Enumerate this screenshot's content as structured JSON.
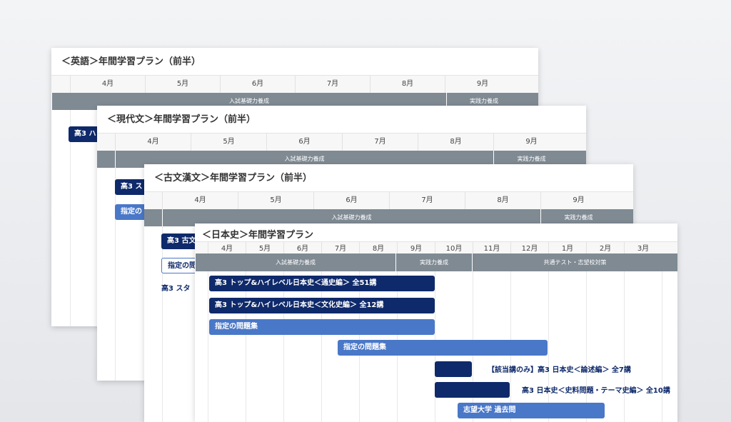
{
  "cards": [
    {
      "title": "＜英語＞年間学習プラン（前半）",
      "months": [
        "4月",
        "5月",
        "6月",
        "7月",
        "8月",
        "9月"
      ],
      "phases": [
        "入試基礎力養成",
        "実践力養成"
      ],
      "bars": [
        "高3 ハ"
      ]
    },
    {
      "title": "＜現代文＞年間学習プラン（前半）",
      "months": [
        "4月",
        "5月",
        "6月",
        "7月",
        "8月",
        "9月"
      ],
      "phases": [
        "入試基礎力養成",
        "実践力養成"
      ],
      "bars": [
        "高3 ス",
        "指定の"
      ]
    },
    {
      "title": "＜古文漢文＞年間学習プラン（前半）",
      "months": [
        "4月",
        "5月",
        "6月",
        "7月",
        "8月",
        "9月"
      ],
      "phases": [
        "入試基礎力養成",
        "実践力養成"
      ],
      "bars": [
        "高3 古文",
        "指定の問",
        "高3 スタ"
      ]
    },
    {
      "title": "＜日本史＞年間学習プラン",
      "months": [
        "4月",
        "5月",
        "6月",
        "7月",
        "8月",
        "9月",
        "10月",
        "11月",
        "12月",
        "1月",
        "2月",
        "3月"
      ],
      "phases": [
        "入試基礎力養成",
        "実践力養成",
        "共通テスト・志望校対策"
      ],
      "bars": [
        "高3 トップ&ハイレベル日本史＜通史編＞ 全51講",
        "高3 トップ&ハイレベル日本史＜文化史編＞ 全12講",
        "指定の問題集",
        "指定の問題集",
        "",
        "【該当講のみ】高3 日本史＜論述編＞ 全7講",
        "",
        "高3 日本史＜史料問題・テーマ史編＞ 全10講",
        "志望大学 過去問"
      ]
    }
  ]
}
